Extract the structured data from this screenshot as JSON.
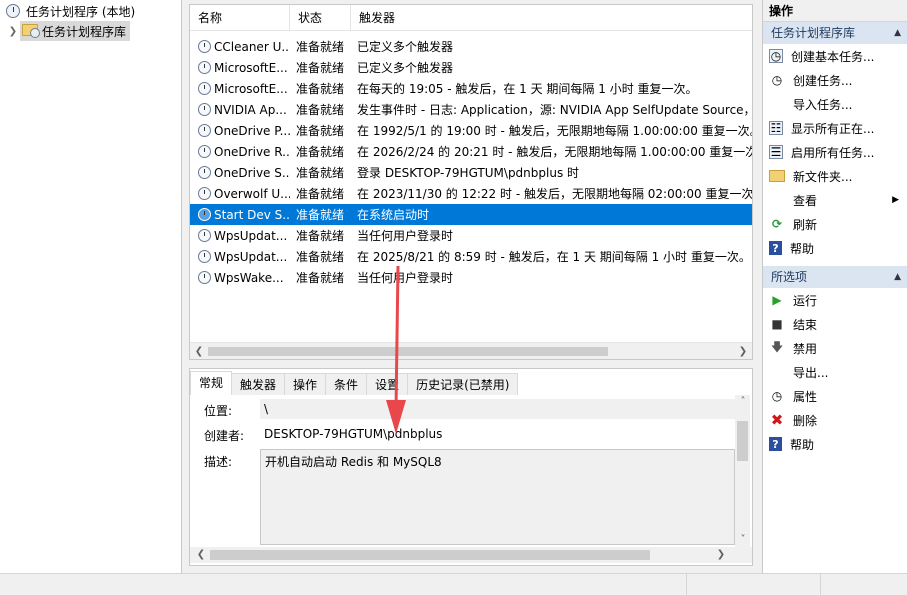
{
  "tree": {
    "root_label": "任务计划程序 (本地)",
    "library_label": "任务计划程序库"
  },
  "task_list": {
    "columns": [
      "名称",
      "状态",
      "触发器"
    ],
    "rows": [
      {
        "name": "CCleaner U...",
        "status": "准备就绪",
        "trigger": "已定义多个触发器"
      },
      {
        "name": "MicrosoftE...",
        "status": "准备就绪",
        "trigger": "已定义多个触发器"
      },
      {
        "name": "MicrosoftE...",
        "status": "准备就绪",
        "trigger": "在每天的 19:05 - 触发后，在 1 天 期间每隔 1 小时 重复一次。"
      },
      {
        "name": "NVIDIA Ap...",
        "status": "准备就绪",
        "trigger": "发生事件时 - 日志: Application，源: NVIDIA App SelfUpdate Source，"
      },
      {
        "name": "OneDrive P...",
        "status": "准备就绪",
        "trigger": "在 1992/5/1 的 19:00 时 - 触发后，无限期地每隔 1.00:00:00 重复一次。"
      },
      {
        "name": "OneDrive R...",
        "status": "准备就绪",
        "trigger": "在 2026/2/24 的 20:21 时 - 触发后，无限期地每隔 1.00:00:00 重复一次。"
      },
      {
        "name": "OneDrive S...",
        "status": "准备就绪",
        "trigger": "登录 DESKTOP-79HGTUM\\pdnbplus 时"
      },
      {
        "name": "Overwolf U...",
        "status": "准备就绪",
        "trigger": "在 2023/11/30 的 12:22 时 - 触发后，无限期地每隔 02:00:00 重复一次。"
      },
      {
        "name": "Start Dev S...",
        "status": "准备就绪",
        "trigger": "在系统启动时",
        "selected": true
      },
      {
        "name": "WpsUpdat...",
        "status": "准备就绪",
        "trigger": "当任何用户登录时"
      },
      {
        "name": "WpsUpdat...",
        "status": "准备就绪",
        "trigger": "在 2025/8/21 的 8:59 时 - 触发后，在 1 天 期间每隔 1 小时 重复一次。"
      },
      {
        "name": "WpsWake...",
        "status": "准备就绪",
        "trigger": "当任何用户登录时"
      }
    ]
  },
  "detail": {
    "tabs": [
      "常规",
      "触发器",
      "操作",
      "条件",
      "设置",
      "历史记录(已禁用)"
    ],
    "location_label": "位置:",
    "location_value": "\\",
    "author_label": "创建者:",
    "author_value": "DESKTOP-79HGTUM\\pdnbplus",
    "desc_label": "描述:",
    "desc_value": "开机自动启动 Redis 和 MySQL8"
  },
  "actions": {
    "title": "操作",
    "section1": "任务计划程序库",
    "items1": [
      {
        "label": "创建基本任务...",
        "icon": "create-basic-task-icon"
      },
      {
        "label": "创建任务...",
        "icon": "create-task-icon"
      },
      {
        "label": "导入任务...",
        "icon": "import-icon"
      },
      {
        "label": "显示所有正在...",
        "icon": "running-tasks-icon"
      },
      {
        "label": "启用所有任务...",
        "icon": "history-icon"
      },
      {
        "label": "新文件夹...",
        "icon": "folder-icon"
      },
      {
        "label": "查看",
        "icon": "view-icon"
      },
      {
        "label": "刷新",
        "icon": "refresh-icon"
      },
      {
        "label": "帮助",
        "icon": "help-icon"
      }
    ],
    "section2": "所选项",
    "items2": [
      {
        "label": "运行",
        "icon": "run-icon"
      },
      {
        "label": "结束",
        "icon": "stop-icon"
      },
      {
        "label": "禁用",
        "icon": "disable-icon"
      },
      {
        "label": "导出...",
        "icon": "export-icon"
      },
      {
        "label": "属性",
        "icon": "properties-icon"
      },
      {
        "label": "删除",
        "icon": "delete-icon"
      },
      {
        "label": "帮助",
        "icon": "help-icon"
      }
    ]
  },
  "colors": {
    "selection": "#0078d7",
    "section_bg": "#dbe5f1",
    "annotation_arrow": "#e8474b"
  }
}
